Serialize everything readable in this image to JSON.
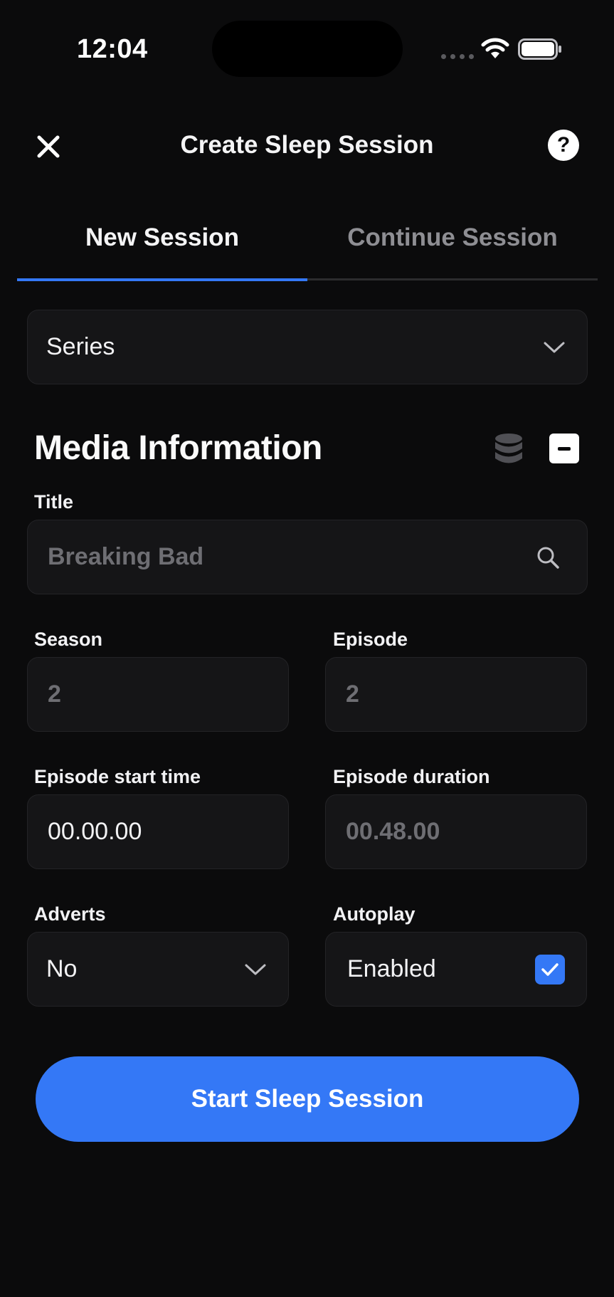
{
  "status_bar": {
    "time": "12:04"
  },
  "header": {
    "title": "Create Sleep Session",
    "help_label": "?"
  },
  "tabs": [
    {
      "label": "New Session",
      "active": true
    },
    {
      "label": "Continue Session",
      "active": false
    }
  ],
  "media_type_select": {
    "value": "Series"
  },
  "media_info": {
    "heading": "Media Information",
    "title": {
      "label": "Title",
      "placeholder": "Breaking Bad"
    },
    "season": {
      "label": "Season",
      "placeholder": "2"
    },
    "episode": {
      "label": "Episode",
      "placeholder": "2"
    },
    "start_time": {
      "label": "Episode start time",
      "value": "00.00.00"
    },
    "duration": {
      "label": "Episode duration",
      "placeholder": "00.48.00"
    },
    "adverts": {
      "label": "Adverts",
      "value": "No"
    },
    "autoplay": {
      "label": "Autoplay",
      "value": "Enabled",
      "checked": true
    }
  },
  "primary_action": {
    "label": "Start Sleep Session"
  },
  "colors": {
    "accent": "#3478f6",
    "background": "#0b0b0c",
    "field": "#151517"
  }
}
